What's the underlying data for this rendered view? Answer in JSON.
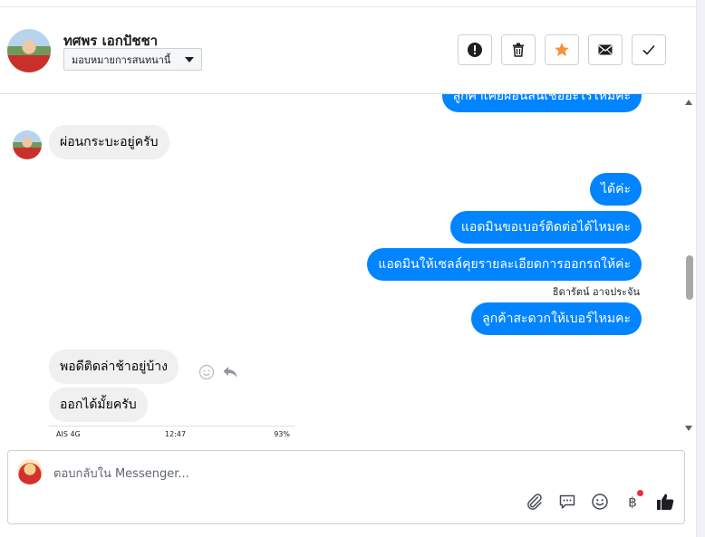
{
  "header": {
    "contact_name": "ทศพร เอกปัชชา",
    "assign_label": "มอบหมายการสนทนานี้",
    "actions": [
      {
        "name": "mark-spam-button",
        "icon": "exclamation-icon"
      },
      {
        "name": "delete-button",
        "icon": "trash-icon"
      },
      {
        "name": "star-button",
        "icon": "star-icon"
      },
      {
        "name": "mark-unread-button",
        "icon": "envelope-icon"
      },
      {
        "name": "mark-done-button",
        "icon": "checkmark-icon"
      }
    ],
    "star_color": "#f7923a"
  },
  "conversation": {
    "outgoing_color": "#0084ff",
    "incoming_color": "#f0f0f0",
    "messages": [
      {
        "from": "page",
        "text": "ลูกค้าเคยผ่อนสินเชื่ออะไรไหมคะ"
      },
      {
        "from": "customer",
        "text": "ผ่อนกระบะอยู่ครับ"
      },
      {
        "from": "page",
        "text": "ได้ค่ะ"
      },
      {
        "from": "page",
        "text": "แอดมินขอเบอร์ติดต่อได้ไหมคะ"
      },
      {
        "from": "page",
        "text": "แอดมินให้เซลล์คุยรายละเอียดการออกรถให้ค่ะ"
      },
      {
        "from": "page",
        "text": "ลูกค้าสะดวกให้เบอร์ไหมคะ",
        "sender": "ธิดารัตน์ อาจประจัน"
      },
      {
        "from": "customer",
        "text": "พอดีติดล่าช้าอยู่บ้าง"
      },
      {
        "from": "customer",
        "text": "ออกได้มั้ยครับ"
      }
    ],
    "screenshot_preview": {
      "carrier": "AIS 4G",
      "time": "12:47",
      "battery": "93%"
    }
  },
  "composer": {
    "placeholder": "ตอบกลับใน Messenger...",
    "tools": [
      "attachment-icon",
      "saved-reply-icon",
      "emoji-icon",
      "baht-payment-icon",
      "like-icon"
    ]
  }
}
